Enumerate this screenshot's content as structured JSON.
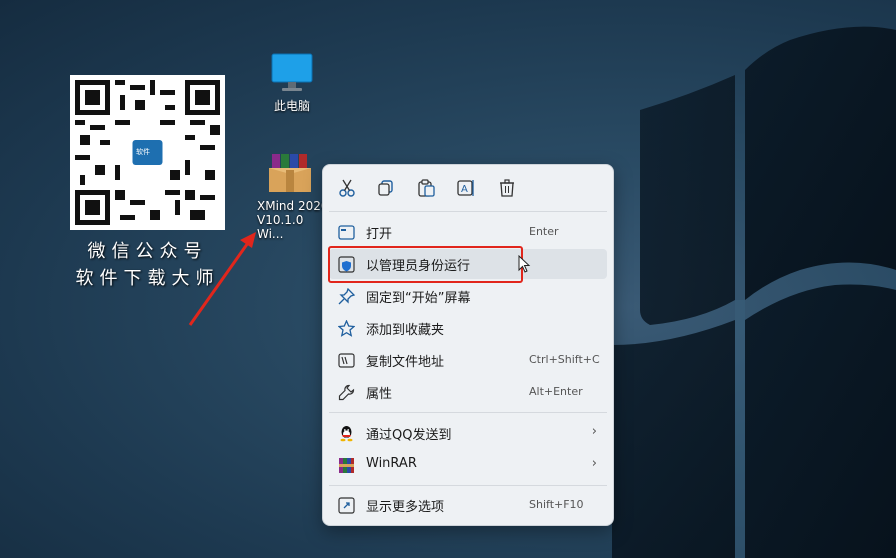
{
  "qr": {
    "caption_line1": "微信公众号",
    "caption_line2": "软件下载大师",
    "logo_text": "软件"
  },
  "desktop": {
    "icons": [
      {
        "label": "此电脑",
        "icon": "monitor-icon"
      },
      {
        "label_line1": "XMind 2020",
        "label_line2": "V10.1.0 Wi...",
        "icon": "winrar-archive-icon"
      }
    ]
  },
  "context_menu": {
    "toolbar": [
      "cut-icon",
      "copy-icon",
      "paste-icon",
      "rename-icon",
      "delete-icon"
    ],
    "items": [
      {
        "label": "打开",
        "shortcut": "Enter",
        "icon": "open-icon"
      },
      {
        "label": "以管理员身份运行",
        "shortcut": "",
        "icon": "shield-icon"
      },
      {
        "label": "固定到“开始”屏幕",
        "shortcut": "",
        "icon": "pin-icon"
      },
      {
        "label": "添加到收藏夹",
        "shortcut": "",
        "icon": "star-icon"
      },
      {
        "label": "复制文件地址",
        "shortcut": "Ctrl+Shift+C",
        "icon": "copy-path-icon"
      },
      {
        "label": "属性",
        "shortcut": "Alt+Enter",
        "icon": "wrench-icon"
      },
      {
        "label": "通过QQ发送到",
        "arrow": "›",
        "icon": "qq-icon"
      },
      {
        "label": "WinRAR",
        "arrow": "›",
        "icon": "winrar-icon"
      },
      {
        "label": "显示更多选项",
        "shortcut": "Shift+F10",
        "icon": "more-options-icon"
      }
    ]
  },
  "colors": {
    "highlight": "#e1261c",
    "accent": "#0067c0"
  }
}
